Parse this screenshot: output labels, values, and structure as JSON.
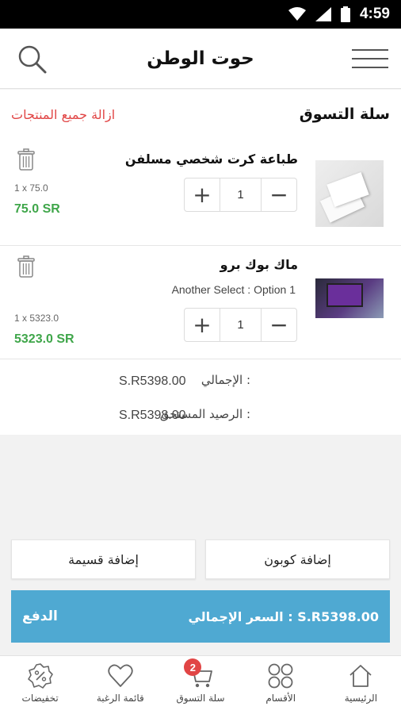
{
  "status_bar": {
    "time": "4:59"
  },
  "header": {
    "title": "حوت الوطن"
  },
  "cart": {
    "title": "سلة التسوق",
    "remove_all": "ازالة جميع المنتجات",
    "items": [
      {
        "name": "طباعة كرت شخصي مسلفن",
        "option": "",
        "quantity": "1",
        "qty_line": "1 x 75.0",
        "price": "75.0 SR"
      },
      {
        "name": "ماك بوك برو",
        "option": "Another Select : Option 1",
        "quantity": "1",
        "qty_line": "1 x 5323.0",
        "price": "5323.0 SR"
      }
    ]
  },
  "totals": {
    "total_label": "الإجمالي :",
    "total_value": "S.R5398.00",
    "due_label": "الرصيد المستحق :",
    "due_value": "S.R5398.00"
  },
  "actions": {
    "add_coupon": "إضافة كوبون",
    "add_voucher": "إضافة قسيمة"
  },
  "checkout": {
    "total_text": "السعر الإجمالي : S.R5398.00",
    "pay_label": "الدفع"
  },
  "nav": {
    "items": [
      {
        "label": "الرئيسية",
        "icon": "home-icon"
      },
      {
        "label": "الأقسام",
        "icon": "categories-icon"
      },
      {
        "label": "سلة التسوق",
        "icon": "cart-icon",
        "badge": "2"
      },
      {
        "label": "قائمة الرغبة",
        "icon": "heart-icon"
      },
      {
        "label": "تخفيضات",
        "icon": "discount-icon"
      }
    ]
  },
  "colors": {
    "accent": "#4fa9d2",
    "price_green": "#3fa64a",
    "remove_red": "#e14545"
  }
}
